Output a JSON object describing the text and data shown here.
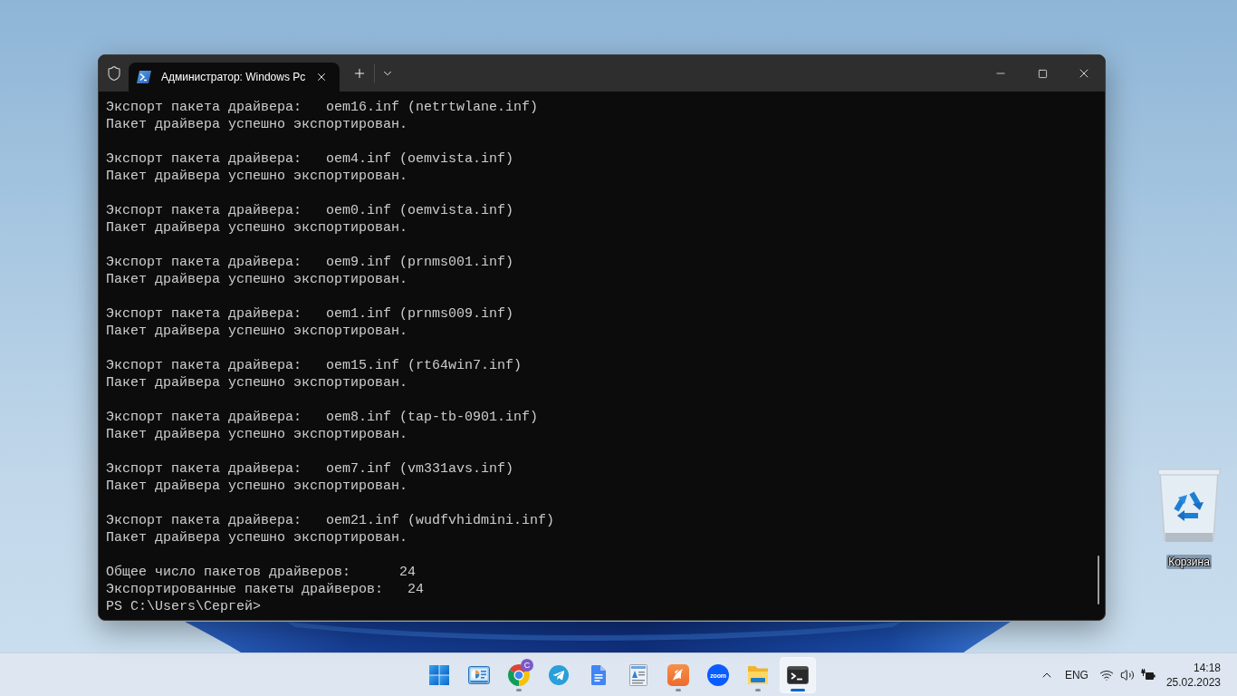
{
  "desktop": {
    "icons": [
      {
        "kind": "recycle_bin",
        "label": "Корзина"
      }
    ]
  },
  "window": {
    "admin": true,
    "tabs": [
      {
        "title": "Администратор: Windows Pc",
        "selected": true
      }
    ],
    "terminal": {
      "output_blocks": [
        [
          "Экспорт пакета драйвера:   oem16.inf (netrtwlane.inf)",
          "Пакет драйвера успешно экспортирован."
        ],
        [
          "Экспорт пакета драйвера:   oem4.inf (oemvista.inf)",
          "Пакет драйвера успешно экспортирован."
        ],
        [
          "Экспорт пакета драйвера:   oem0.inf (oemvista.inf)",
          "Пакет драйвера успешно экспортирован."
        ],
        [
          "Экспорт пакета драйвера:   oem9.inf (prnms001.inf)",
          "Пакет драйвера успешно экспортирован."
        ],
        [
          "Экспорт пакета драйвера:   oem1.inf (prnms009.inf)",
          "Пакет драйвера успешно экспортирован."
        ],
        [
          "Экспорт пакета драйвера:   oem15.inf (rt64win7.inf)",
          "Пакет драйвера успешно экспортирован."
        ],
        [
          "Экспорт пакета драйвера:   oem8.inf (tap-tb-0901.inf)",
          "Пакет драйвера успешно экспортирован."
        ],
        [
          "Экспорт пакета драйвера:   oem7.inf (vm331avs.inf)",
          "Пакет драйвера успешно экспортирован."
        ],
        [
          "Экспорт пакета драйвера:   oem21.inf (wudfvhidmini.inf)",
          "Пакет драйвера успешно экспортирован."
        ]
      ],
      "summary": [
        "Общее число пакетов драйверов:      24",
        "Экспортированные пакеты драйверов:   24"
      ],
      "prompt": "PS C:\\Users\\Сергей>"
    }
  },
  "taskbar": {
    "apps": [
      {
        "kind": "start",
        "running": false,
        "selected": false
      },
      {
        "kind": "widgets",
        "running": false,
        "selected": false
      },
      {
        "kind": "browser",
        "badge": "C",
        "running": true,
        "selected": false
      },
      {
        "kind": "messenger",
        "running": false,
        "selected": false
      },
      {
        "kind": "docs",
        "running": false,
        "selected": false
      },
      {
        "kind": "notepad",
        "running": false,
        "selected": false
      },
      {
        "kind": "bird_app",
        "running": true,
        "selected": false
      },
      {
        "kind": "video",
        "logo_text": "zoom",
        "running": false,
        "selected": false
      },
      {
        "kind": "folder",
        "running": true,
        "selected": false
      },
      {
        "kind": "terminal",
        "running": true,
        "selected": true
      }
    ]
  },
  "tray": {
    "language": "ENG",
    "time": "14:18",
    "date": "25.02.2023"
  }
}
